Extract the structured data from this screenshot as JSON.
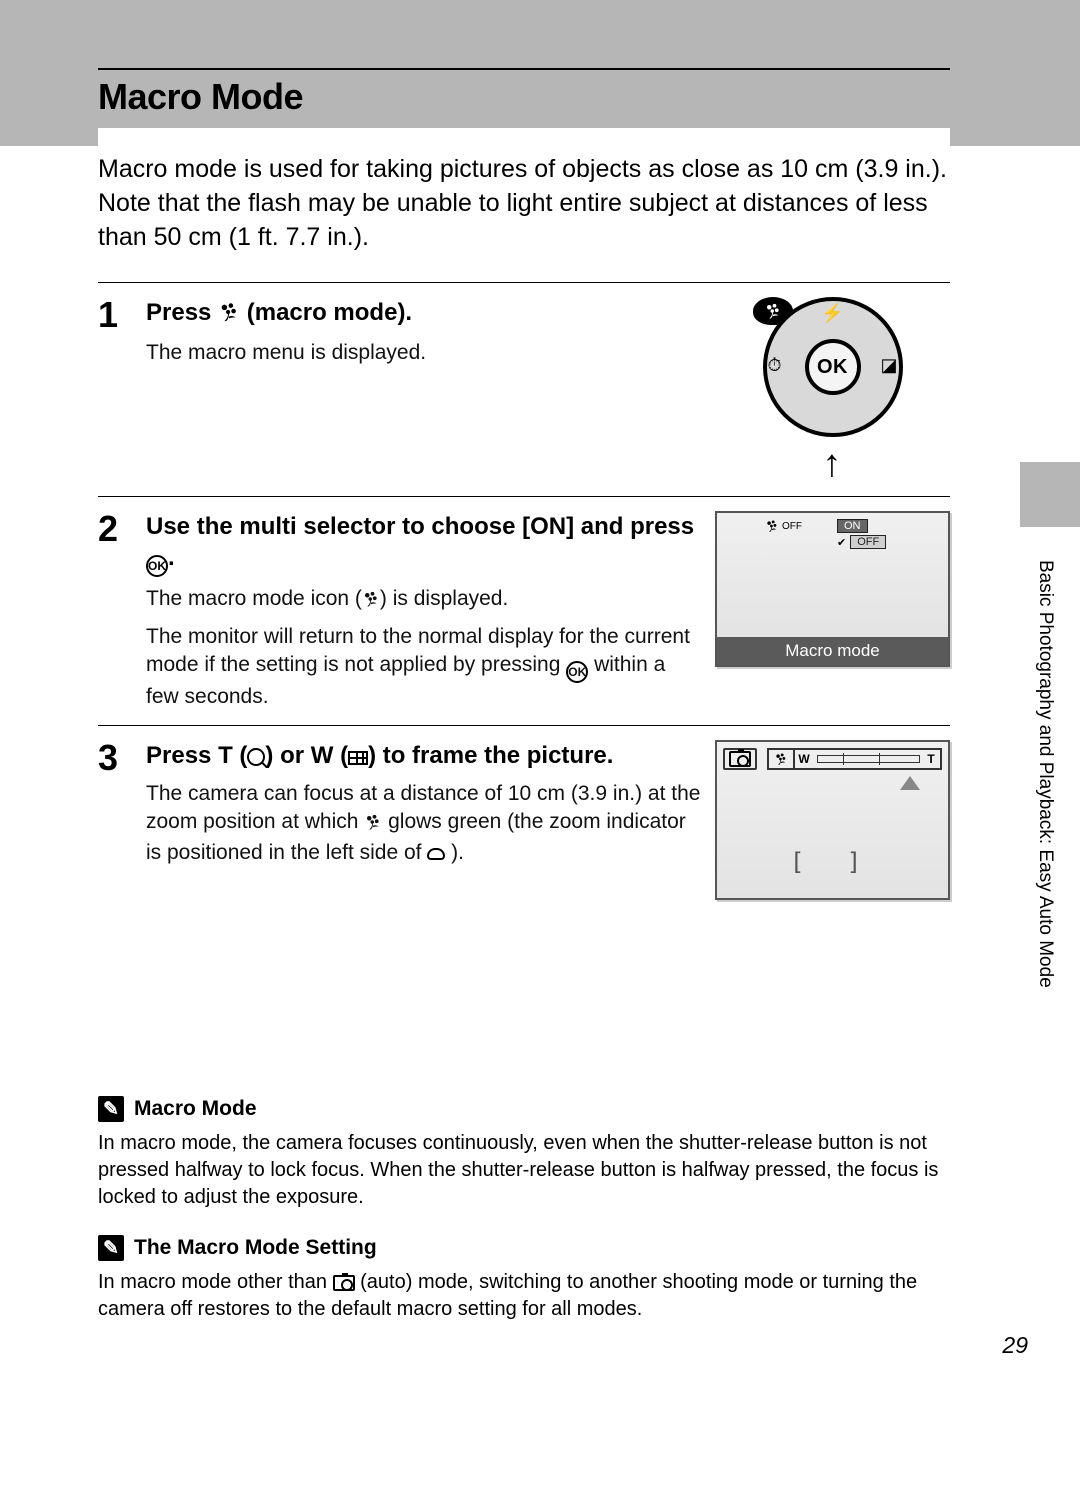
{
  "header": {
    "title": "Macro Mode"
  },
  "intro": "Macro mode is used for taking pictures of objects as close as 10 cm (3.9 in.). Note that the flash may be unable to light entire subject at distances of less than 50 cm (1 ft. 7.7 in.).",
  "steps": [
    {
      "num": "1",
      "title_before": "Press ",
      "title_after": " (macro mode).",
      "desc": [
        "The macro menu is displayed."
      ],
      "dial": {
        "center": "OK",
        "up_icon": "flash-icon",
        "down_icon": "macro-icon",
        "left_icon": "self-timer-icon",
        "right_icon": "exposure-comp-icon",
        "arrow": "↑"
      }
    },
    {
      "num": "2",
      "title_plain": "Use the multi selector to choose [ON] and press ",
      "title_after": ".",
      "desc": [
        "The macro mode icon (  ) is displayed.",
        "The monitor will return to the normal display for the current mode if the setting is not applied by pressing     within a few seconds."
      ],
      "lcd": {
        "top_icon_label": "macro-off-icon",
        "on_label": "ON",
        "off_label": "OFF",
        "caption": "Macro mode"
      }
    },
    {
      "num": "3",
      "title_segments": {
        "a": "Press ",
        "t": "T",
        "b": " (",
        "c": ") or ",
        "w": "W",
        "d": " (",
        "e": ") to frame the picture."
      },
      "desc": [
        "The camera can focus at a distance of 10 cm (3.9 in.) at the zoom position at which     glows green (the zoom indicator is positioned in the left side of     )."
      ],
      "lcd2": {
        "cam_icon": "camera-icon",
        "macro_seg_icon": "macro-icon",
        "w_label": "W",
        "t_label": "T",
        "brackets": "[   ]"
      }
    }
  ],
  "notes": [
    {
      "title": "Macro Mode",
      "body": "In macro mode, the camera focuses continuously, even when the shutter-release button is not pressed halfway to lock focus. When the shutter-release button is halfway pressed, the focus is locked to adjust the exposure."
    },
    {
      "title": "The Macro Mode Setting",
      "body_before": "In macro mode other than ",
      "body_after": " (auto) mode, switching to another shooting mode or turning the camera off restores to the default macro setting for all modes."
    }
  ],
  "side_label": "Basic Photography and Playback: Easy Auto Mode",
  "page_number": "29"
}
